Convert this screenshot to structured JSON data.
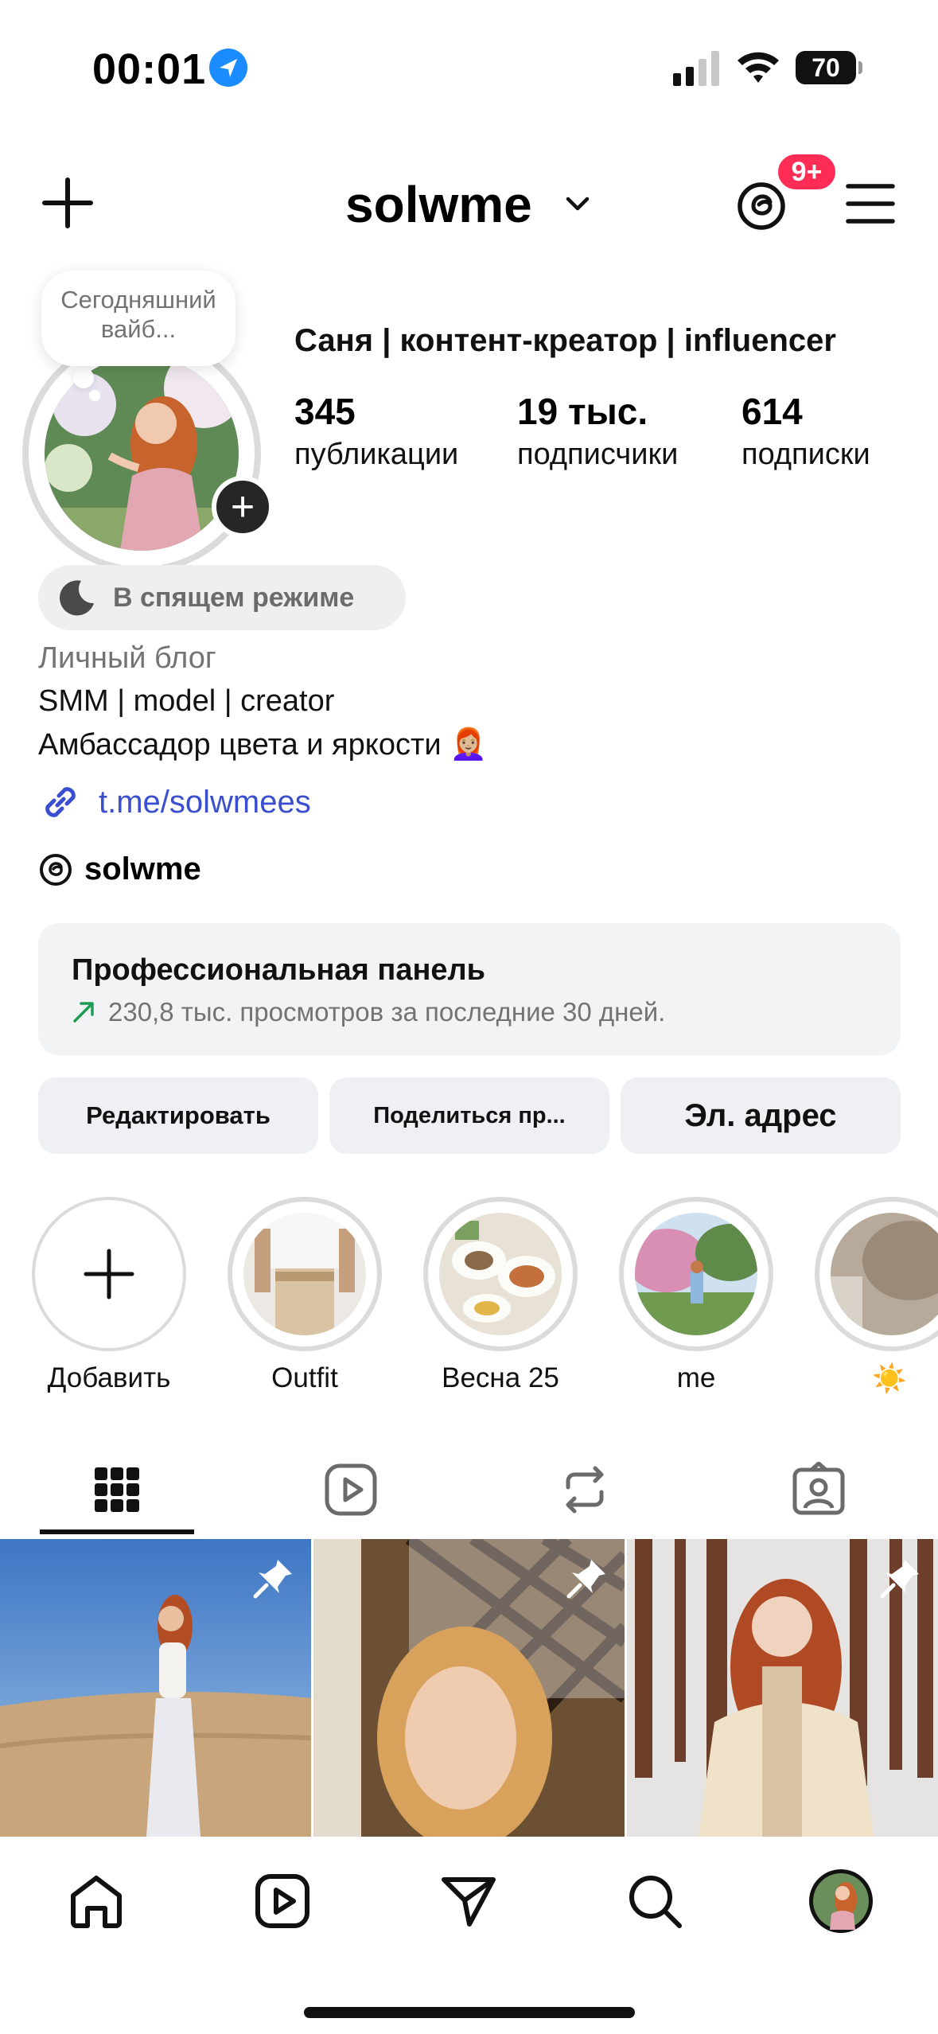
{
  "status_bar": {
    "time": "00:01",
    "battery": "70"
  },
  "header": {
    "username": "solwme",
    "notification_badge": "9+"
  },
  "note": {
    "text": "Сегодняшний вайб..."
  },
  "profile": {
    "display_title": "Саня | контент-креатор | influencer",
    "stats": [
      {
        "value": "345",
        "label": "публикации"
      },
      {
        "value": "19 тыс.",
        "label": "подписчики"
      },
      {
        "value": "614",
        "label": "подписки"
      }
    ],
    "status": "В спящем режиме",
    "category": "Личный блог",
    "bio_lines": [
      "SMM | model | creator",
      "Амбассадор цвета и яркости 👩🏼‍🦰"
    ],
    "link": "t.me/solwmees",
    "threads_handle": "solwme"
  },
  "pro_panel": {
    "title": "Профессиональная панель",
    "subtitle": "230,8 тыс. просмотров за последние 30 дней."
  },
  "buttons": {
    "edit": "Редактировать",
    "share": "Поделиться пр...",
    "email": "Эл. адрес"
  },
  "highlights": [
    {
      "label": "Добавить"
    },
    {
      "label": "Outfit"
    },
    {
      "label": "Весна 25"
    },
    {
      "label": "me"
    },
    {
      "label": "☀️"
    }
  ],
  "colors": {
    "accent_link": "#3a4fd0",
    "badge": "#ff2d55",
    "trend_arrow": "#1f9d55"
  },
  "icons": {
    "header": [
      "plus-icon",
      "chevron-down-icon",
      "threads-icon",
      "menu-icon"
    ],
    "tabs": [
      "grid-icon",
      "reels-icon",
      "reposts-icon",
      "tagged-icon"
    ],
    "nav": [
      "home-icon",
      "reels-icon",
      "send-icon",
      "search-icon",
      "profile-avatar"
    ]
  }
}
